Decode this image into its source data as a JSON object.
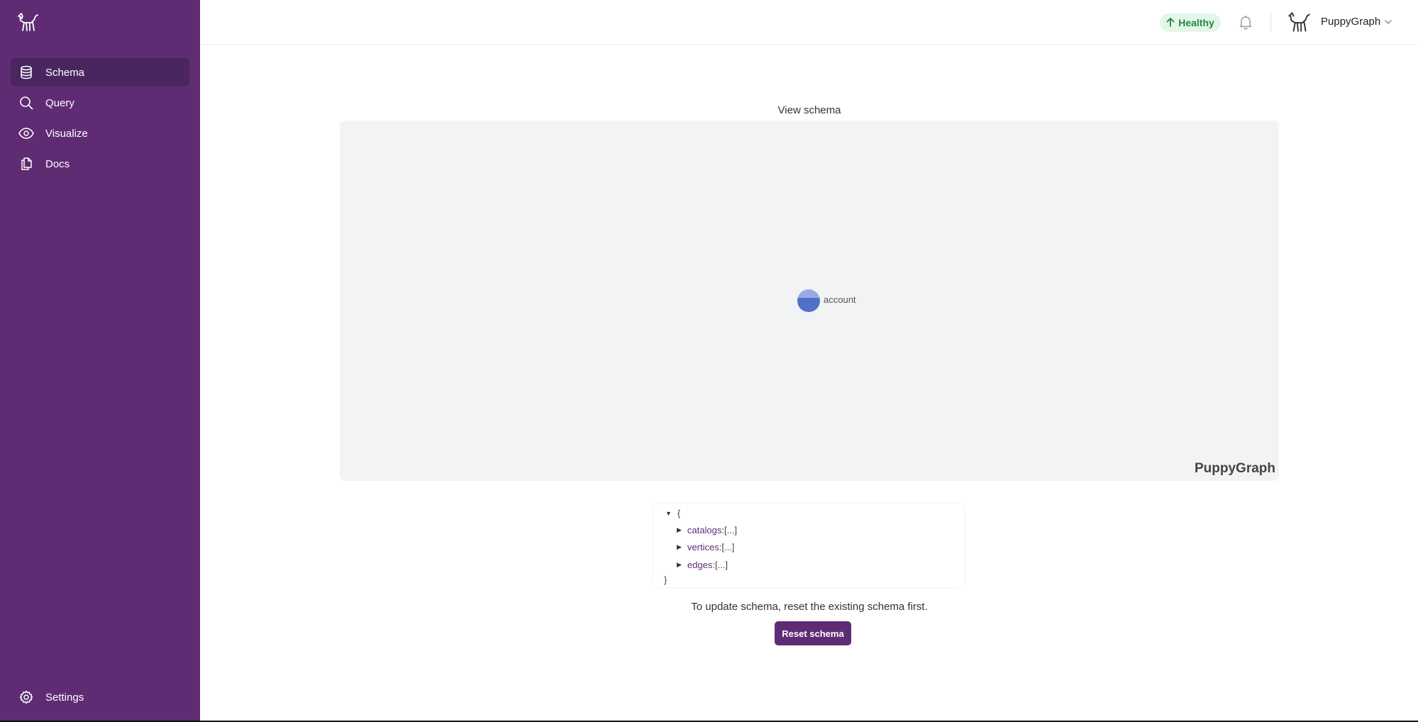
{
  "sidebar": {
    "logo_icon": "puppy-logo-icon",
    "items": [
      {
        "label": "Schema",
        "icon": "database-icon",
        "active": true
      },
      {
        "label": "Query",
        "icon": "search-icon"
      },
      {
        "label": "Visualize",
        "icon": "eye-icon"
      },
      {
        "label": "Docs",
        "icon": "documents-icon"
      }
    ],
    "settings": {
      "label": "Settings",
      "icon": "gear-icon"
    }
  },
  "header": {
    "status": {
      "label": "Healthy",
      "icon": "arrow-up-icon",
      "color": "#1f8a45",
      "background": "#e3f6e8"
    },
    "notification_icon": "bell-icon",
    "user": {
      "name": "PuppyGraph",
      "avatar": "puppy-avatar-icon",
      "menu_icon": "chevron-down-icon"
    }
  },
  "main": {
    "view_title": "View schema",
    "graph": {
      "node_label": "account",
      "watermark": "PuppyGraph"
    },
    "json_tree": {
      "open_brace": "{",
      "close_brace": "}",
      "entries": [
        {
          "key": "catalogs",
          "value": "[...]"
        },
        {
          "key": "vertices",
          "value": "[...]"
        },
        {
          "key": "edges",
          "value": "[...]"
        }
      ]
    },
    "update_text": "To update schema, reset the existing schema first.",
    "reset_button": "Reset schema"
  },
  "colors": {
    "sidebar_bg": "#5f2c73",
    "sidebar_active": "#4a2660",
    "accent": "#5f2c73",
    "node": "#5170c9"
  }
}
